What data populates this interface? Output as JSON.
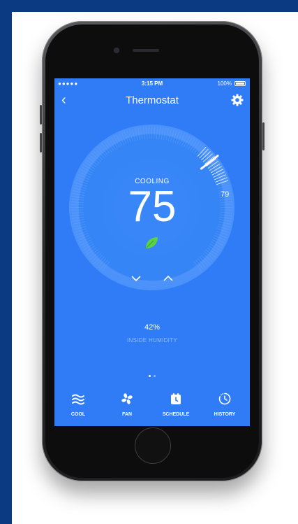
{
  "status_bar": {
    "carrier": "●●●●● ",
    "time": "3:15 PM",
    "battery": "100%"
  },
  "nav": {
    "title": "Thermostat",
    "back_icon": "chevron-left-icon",
    "settings_icon": "gear-icon"
  },
  "thermostat": {
    "mode": "COOLING",
    "target_temp": "75",
    "current_temp": "79",
    "eco_icon": "leaf-icon",
    "humidity_value": "42%",
    "humidity_label": "INSIDE HUMIDITY"
  },
  "page_indicator": {
    "count": 2,
    "active": 0
  },
  "tabs": [
    {
      "label": "COOL",
      "icon": "cool-waves-icon"
    },
    {
      "label": "FAN",
      "icon": "fan-icon"
    },
    {
      "label": "SCHEDULE",
      "icon": "calendar-icon"
    },
    {
      "label": "HISTORY",
      "icon": "history-clock-icon"
    }
  ],
  "colors": {
    "screen_bg": "#2f7cf6",
    "page_bg": "#0b3a82",
    "leaf": "#5cd146"
  }
}
